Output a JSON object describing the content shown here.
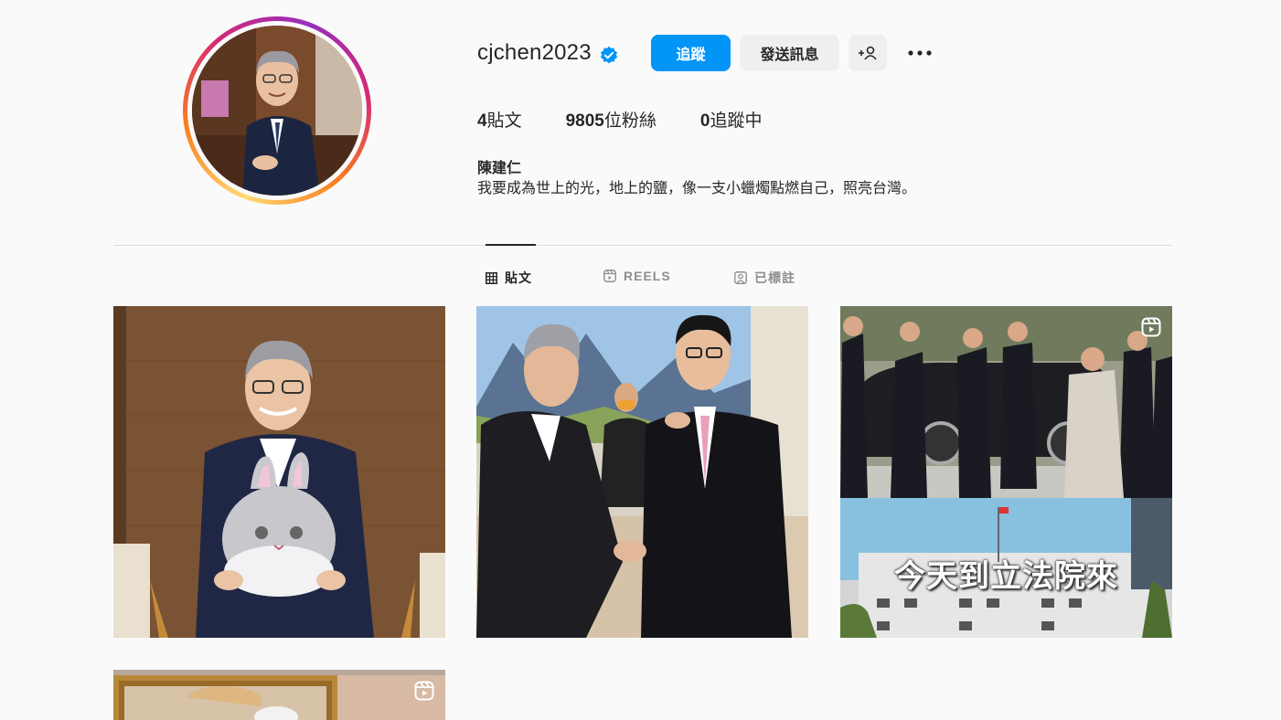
{
  "profile": {
    "username": "cjchen2023",
    "verified": true,
    "full_name": "陳建仁",
    "bio": "我要成為世上的光，地上的鹽，像一支小蠟燭點燃自己，照亮台灣。",
    "avatar_icon": "profile-photo"
  },
  "actions": {
    "follow_label": "追蹤",
    "message_label": "發送訊息",
    "suggest_icon": "add-person-icon",
    "more_icon": "more-options-icon"
  },
  "stats": {
    "posts_count": "4",
    "posts_label": "貼文",
    "followers_count": "9805",
    "followers_label": "位粉絲",
    "following_count": "0",
    "following_label": "追蹤中"
  },
  "tabs": [
    {
      "label": "貼文",
      "icon": "grid-icon",
      "active": true
    },
    {
      "label": "REELS",
      "icon": "reels-icon",
      "active": false
    },
    {
      "label": "已標註",
      "icon": "tagged-icon",
      "active": false
    }
  ],
  "posts": [
    {
      "kind": "photo",
      "overlay": ""
    },
    {
      "kind": "photo",
      "overlay": ""
    },
    {
      "kind": "reel",
      "overlay": "今天到立法院來"
    },
    {
      "kind": "reel",
      "overlay": ""
    }
  ],
  "colors": {
    "accent": "#0095f6",
    "verified": "#0095f6",
    "divider": "#dbdbdb",
    "muted": "#8e8e8e"
  }
}
